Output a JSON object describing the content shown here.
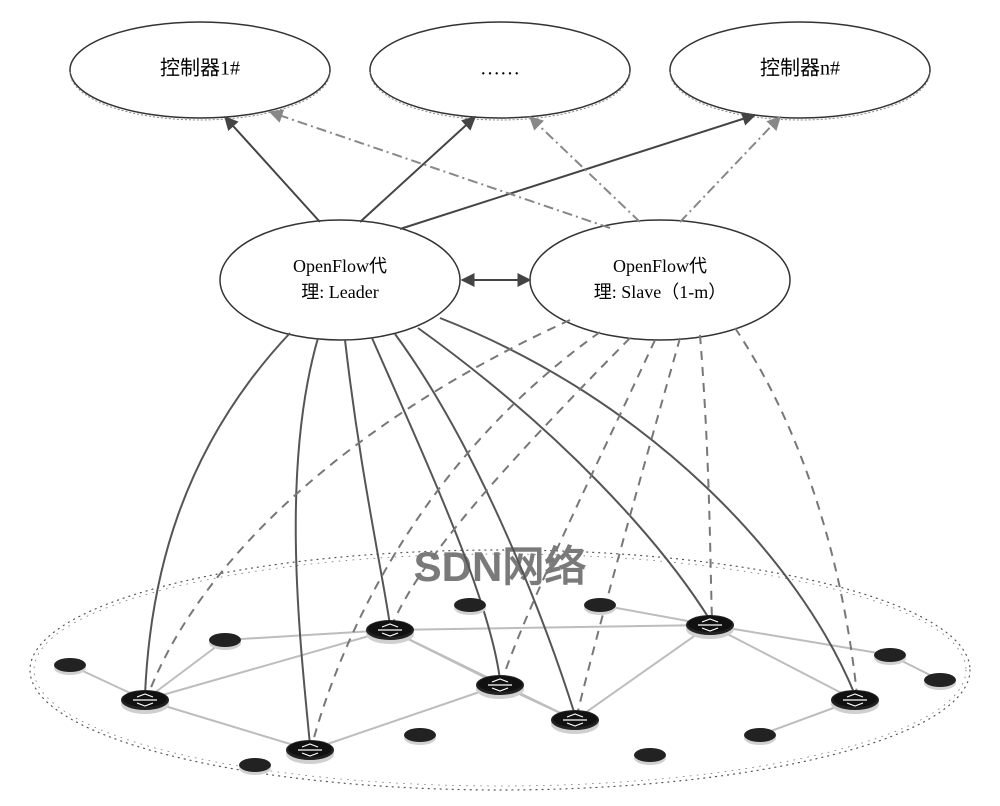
{
  "controllers": {
    "left": "控制器1#",
    "middle": "……",
    "right": "控制器n#"
  },
  "proxies": {
    "leader_line1": "OpenFlow代",
    "leader_line2": "理: Leader",
    "slave_line1": "OpenFlow代",
    "slave_line2": "理: Slave（1-m）"
  },
  "network_label": "SDN网络"
}
